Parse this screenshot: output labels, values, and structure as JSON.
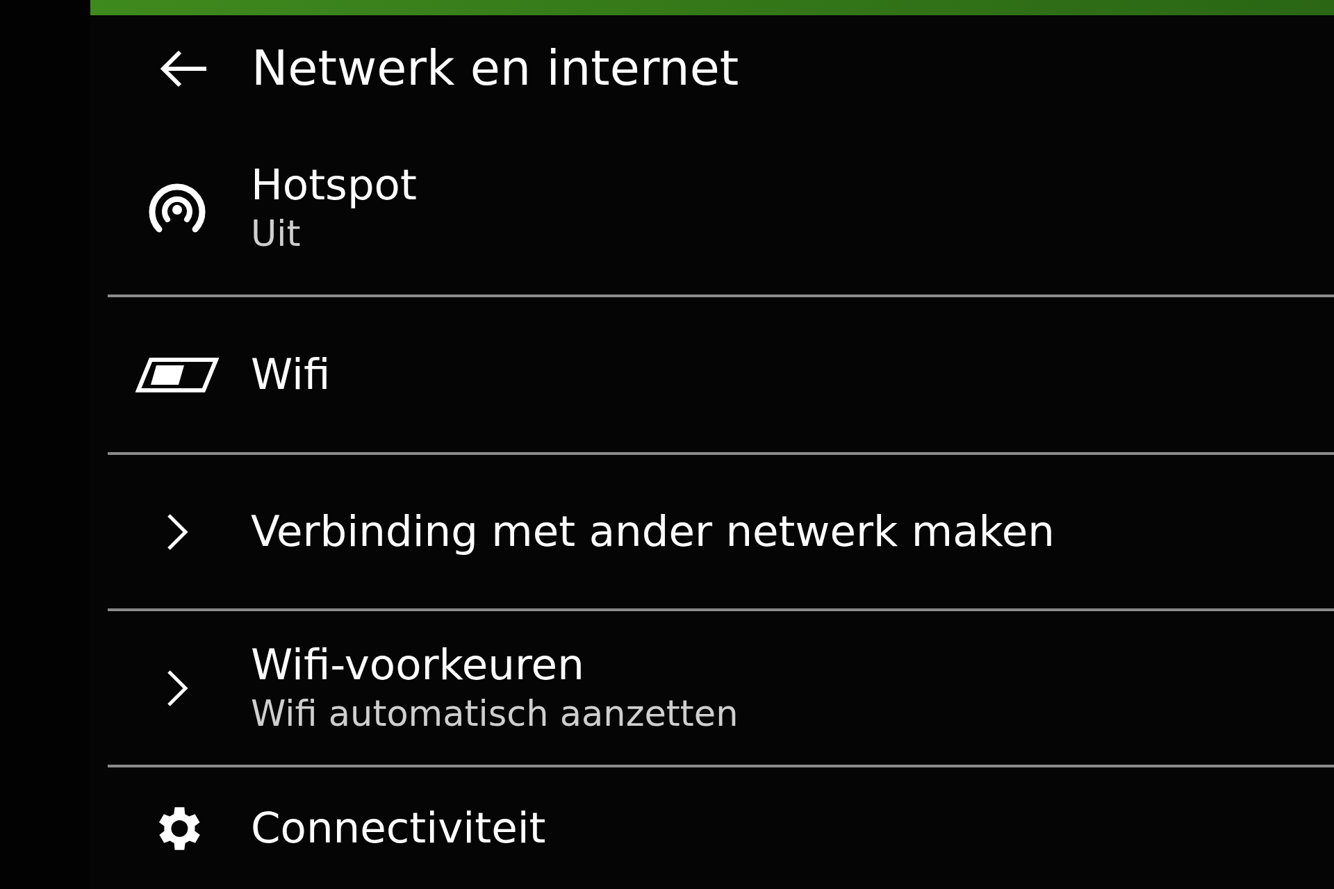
{
  "header": {
    "title": "Netwerk en internet"
  },
  "items": [
    {
      "kind": "hotspot",
      "title": "Hotspot",
      "subtitle": "Uit"
    },
    {
      "kind": "device",
      "title": "Wifi"
    },
    {
      "kind": "link",
      "title": "Verbinding met ander netwerk maken"
    },
    {
      "kind": "link",
      "title": "Wifi-voorkeuren",
      "subtitle": "Wifi automatisch aanzetten"
    },
    {
      "kind": "settings",
      "title": "Connectiviteit"
    }
  ]
}
